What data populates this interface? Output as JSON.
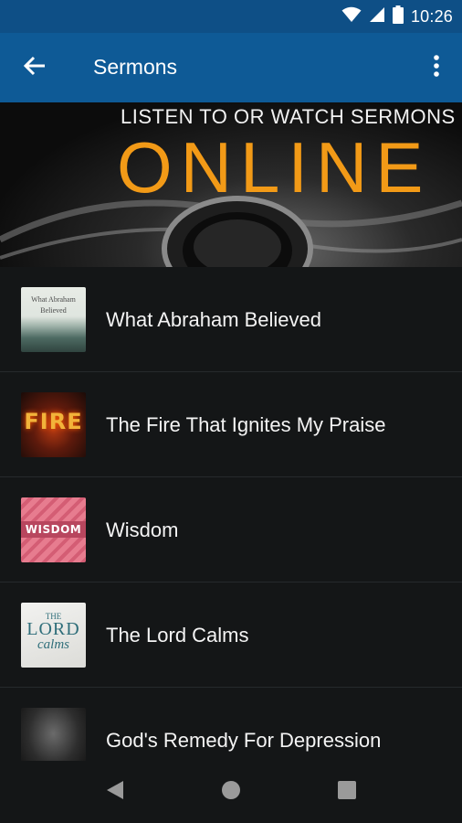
{
  "status_bar": {
    "time": "10:26"
  },
  "app_bar": {
    "title": "Sermons"
  },
  "banner": {
    "headline": "LISTEN TO OR WATCH SERMONS",
    "big_text": "ONLINE"
  },
  "sermons": [
    {
      "title": "What Abraham Believed",
      "thumb_text": "What Abraham Believed"
    },
    {
      "title": "The Fire That Ignites My Praise",
      "thumb_text": "FIRE"
    },
    {
      "title": "Wisdom",
      "thumb_text": "WISDOM"
    },
    {
      "title": "The Lord Calms",
      "thumb_the": "THE",
      "thumb_lord": "LORD",
      "thumb_calms": "calms"
    },
    {
      "title": "God's Remedy For Depression"
    }
  ],
  "colors": {
    "status_bar": "#0e4f86",
    "app_bar": "#0e5a96",
    "background": "#141617",
    "accent_orange": "#f29a17"
  },
  "icons": [
    "wifi-icon",
    "signal-icon",
    "battery-icon",
    "back-arrow-icon",
    "more-vert-icon",
    "nav-back-icon",
    "nav-home-icon",
    "nav-recents-icon"
  ]
}
